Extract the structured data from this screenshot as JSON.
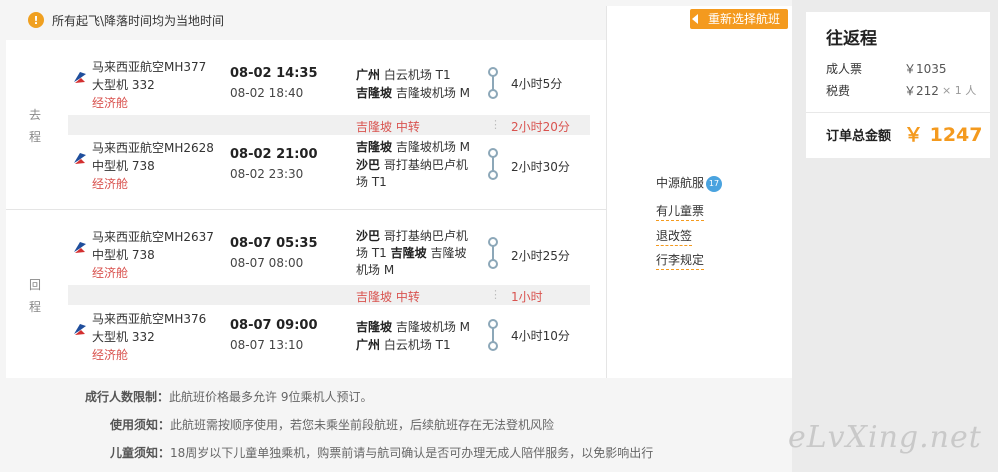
{
  "notice": {
    "icon": "!",
    "text": "所有起飞\\降落时间均为当地时间"
  },
  "reselect_label": "重新选择航班",
  "outbound": {
    "label_1": "去",
    "label_2": "程",
    "seg1": {
      "name": "马来西亚航空MH377",
      "plane": "大型机 332",
      "cabin": "经济舱",
      "dep_time": "08-02 14:35",
      "arr_time": "08-02 18:40",
      "dep_city": "广州",
      "dep_airport": "白云机场 T1",
      "arr_city": "吉隆坡",
      "arr_airport": "吉隆坡机场 M",
      "duration": "4小时5分"
    },
    "transfer": {
      "city": "吉隆坡",
      "text": "中转",
      "duration": "2小时20分"
    },
    "seg2": {
      "name": "马来西亚航空MH2628",
      "plane": "中型机 738",
      "cabin": "经济舱",
      "dep_time": "08-02 21:00",
      "arr_time": "08-02 23:30",
      "dep_city": "吉隆坡",
      "dep_airport": "吉隆坡机场 M",
      "arr_city": "沙巴",
      "arr_airport_1": "哥打基纳巴卢机",
      "arr_airport_2": "场 T1",
      "duration": "2小时30分"
    }
  },
  "inbound": {
    "label_1": "回",
    "label_2": "程",
    "seg1": {
      "name": "马来西亚航空MH2637",
      "plane": "中型机 738",
      "cabin": "经济舱",
      "dep_time": "08-07 05:35",
      "arr_time": "08-07 08:00",
      "dep_city": "沙巴",
      "dep_airport_1": "哥打基纳巴卢机",
      "dep_airport_2": "场 T1",
      "arr_city": "吉隆坡",
      "arr_airport": "吉隆坡机场 M",
      "duration": "2小时25分"
    },
    "transfer": {
      "city": "吉隆坡",
      "text": "中转",
      "duration": "1小时"
    },
    "seg2": {
      "name": "马来西亚航空MH376",
      "plane": "大型机 332",
      "cabin": "经济舱",
      "dep_time": "08-07 09:00",
      "arr_time": "08-07 13:10",
      "dep_city": "吉隆坡",
      "dep_airport": "吉隆坡机场 M",
      "arr_city": "广州",
      "arr_airport": "白云机场 T1",
      "duration": "4小时10分"
    }
  },
  "service": {
    "agent": "中源航服",
    "badge": "17",
    "child_ticket": "有儿童票",
    "refund": "退改签",
    "baggage": "行李规定"
  },
  "rules": {
    "adult_label": "成行人数限制：",
    "adult_text": "此航班价格最多允许 9位乘机人预订。",
    "usage_label": "使用须知：",
    "usage_text": "此航班需按顺序使用，若您未乘坐前段航班，后续航班存在无法登机风险",
    "child_label": "儿童须知：",
    "child_text": "18周岁以下儿童单独乘机，购票前请与航司确认是否可办理无成人陪伴服务，以免影响出行"
  },
  "summary": {
    "title": "往返程",
    "adult_label": "成人票",
    "adult_price": "￥1035",
    "tax_label": "税费",
    "tax_price": "￥212",
    "multiplier": "× 1 人",
    "total_label": "订单总金额",
    "total_price": "￥ 1247"
  },
  "watermark": "eLvXing.net",
  "colors": {
    "accent": "#f49a1e",
    "transfer": "#d9534f",
    "airline_logo": "#1f4e9c"
  }
}
